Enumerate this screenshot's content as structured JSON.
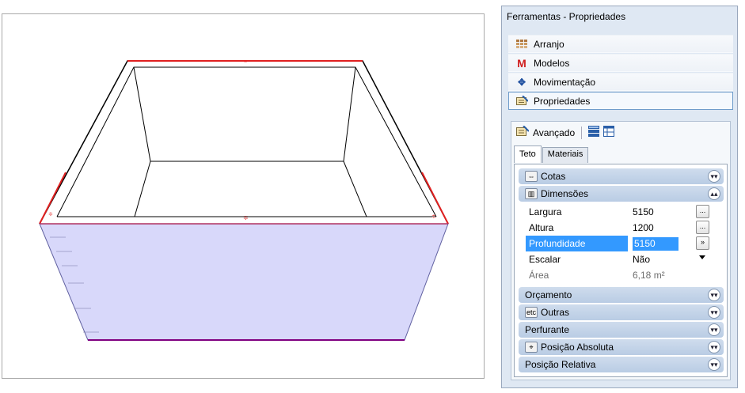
{
  "panel": {
    "title": "Ferramentas - Propriedades",
    "nav": [
      {
        "label": "Arranjo",
        "icon": "grid-icon"
      },
      {
        "label": "Modelos",
        "icon": "models-icon"
      },
      {
        "label": "Movimentação",
        "icon": "move-icon"
      },
      {
        "label": "Propriedades",
        "icon": "properties-icon"
      }
    ],
    "advanced_label": "Avançado",
    "tabs": [
      "Teto",
      "Materiais"
    ],
    "categories": {
      "cotas": "Cotas",
      "dimensoes": "Dimensões",
      "orcamento": "Orçamento",
      "outras": "Outras",
      "outras_icon_text": "etc",
      "perfurante": "Perfurante",
      "posicao_absoluta": "Posição Absoluta",
      "posicao_relativa": "Posição Relativa"
    },
    "properties": {
      "largura": {
        "label": "Largura",
        "value": "5150",
        "button": "..."
      },
      "altura": {
        "label": "Altura",
        "value": "1200",
        "button": "..."
      },
      "profundidade": {
        "label": "Profundidade",
        "value": "5150",
        "button": "»"
      },
      "escalar": {
        "label": "Escalar",
        "value": "Não"
      },
      "area": {
        "label": "Área",
        "value": "6,18 m²"
      }
    }
  },
  "colors": {
    "panel_bg": "#dfe8f3",
    "category_bg": "#c4d4e8",
    "selection": "#3399ff",
    "wall_fill": "#d8d8f8",
    "edge_highlight": "#e02020"
  }
}
